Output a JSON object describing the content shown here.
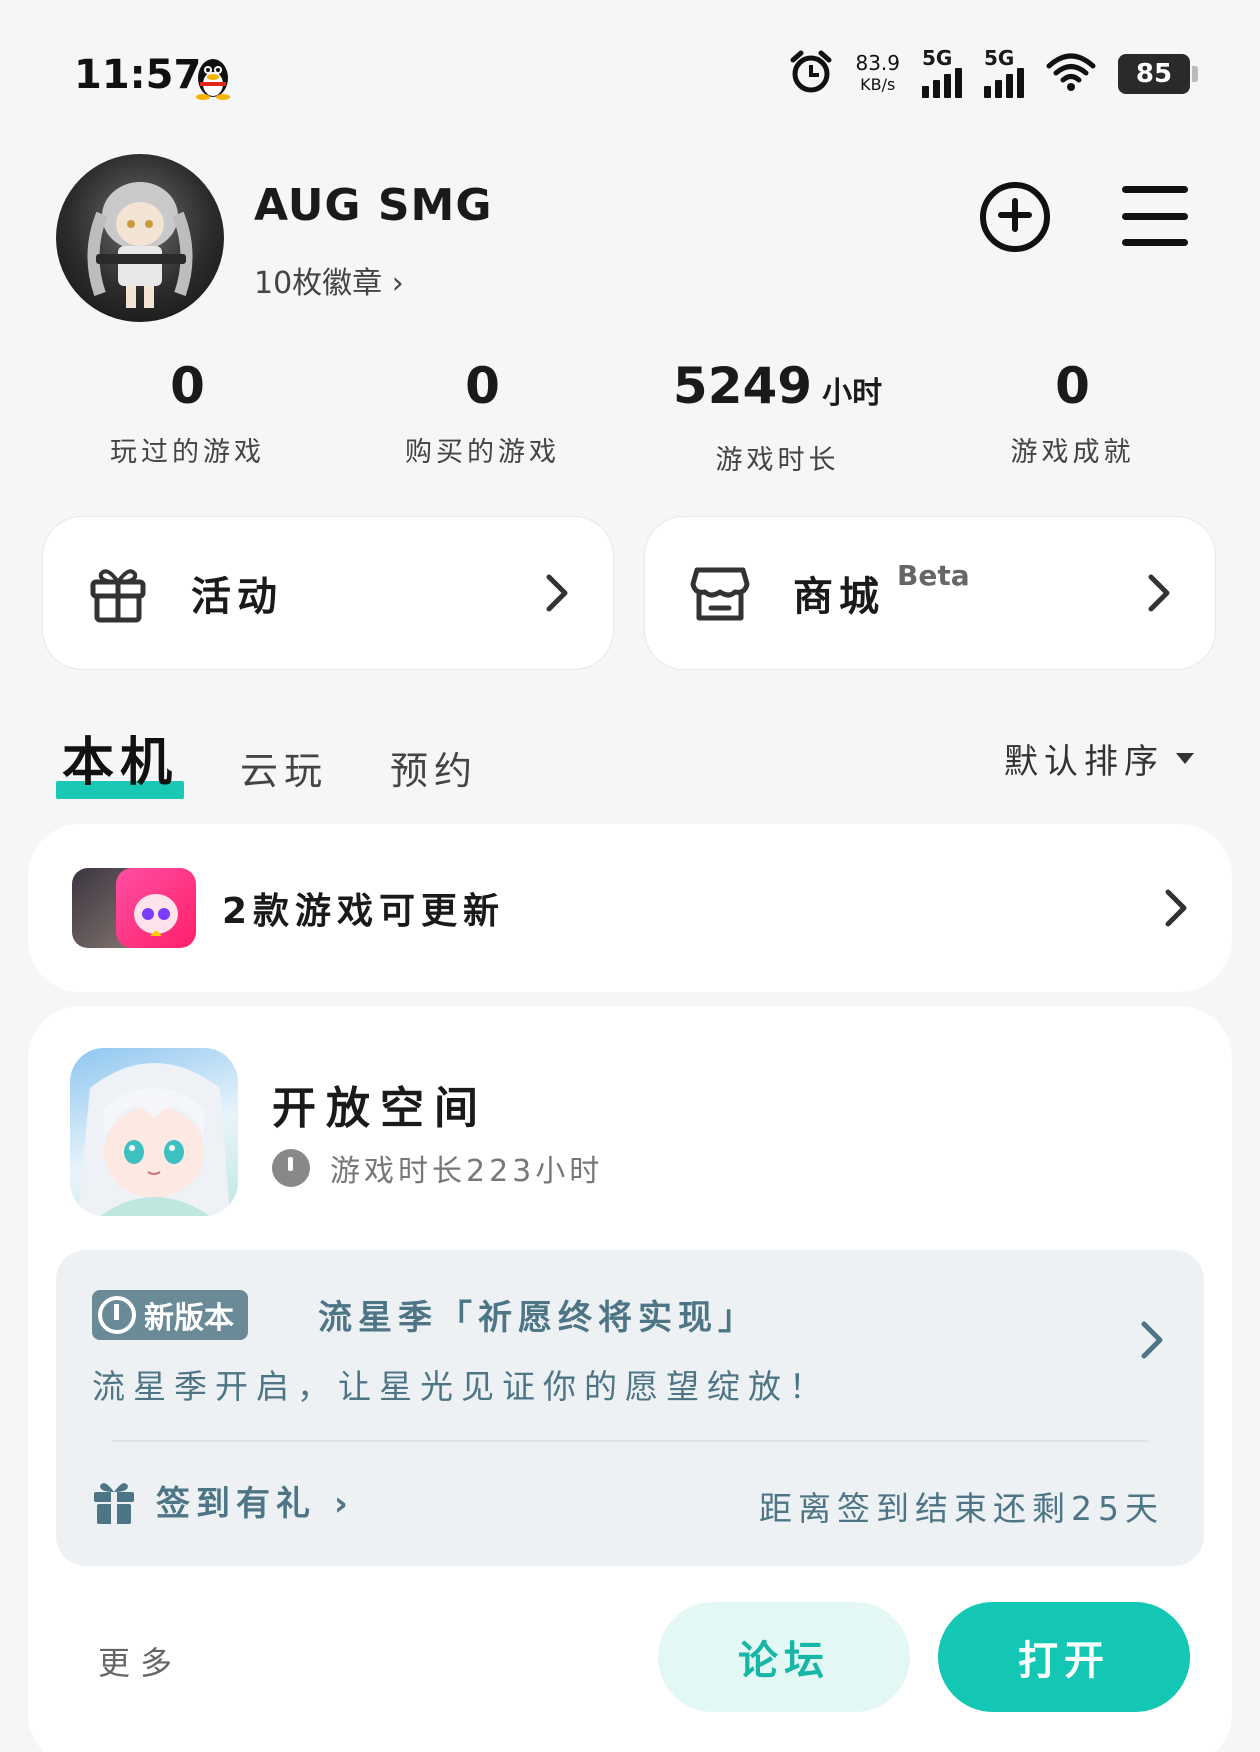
{
  "status_bar": {
    "time": "11:57",
    "net_speed_value": "83.9",
    "net_speed_unit": "KB/s",
    "sim1": "5G",
    "sim2": "5G",
    "battery": "85"
  },
  "profile": {
    "username": "AUG SMG",
    "badges": "10枚徽章 ›"
  },
  "stats": [
    {
      "value": "0",
      "unit": "",
      "label": "玩过的游戏"
    },
    {
      "value": "0",
      "unit": "",
      "label": "购买的游戏"
    },
    {
      "value": "5249",
      "unit": "小时",
      "label": "游戏时长"
    },
    {
      "value": "0",
      "unit": "",
      "label": "游戏成就"
    }
  ],
  "quick": {
    "activity": "活动",
    "shop": "商城",
    "shop_badge": "Beta"
  },
  "tabs": [
    "本机",
    "云玩",
    "预约"
  ],
  "sort_label": "默认排序",
  "update_card": {
    "text": "2款游戏可更新"
  },
  "game": {
    "name": "开放空间",
    "play_time": "游戏时长223小时",
    "news_tag": "新版本",
    "news_title": "流星季「祈愿终将实现」",
    "news_desc": "流星季开启，让星光见证你的愿望绽放！",
    "checkin": "签到有礼 ›",
    "checkin_remaining": "距离签到结束还剩25天",
    "more": "更多",
    "forum_button": "论坛",
    "open_button": "打开"
  },
  "colors": {
    "accent": "#14c7b4",
    "accent_light": "#e3f8f5",
    "news_text": "#4d7585"
  }
}
